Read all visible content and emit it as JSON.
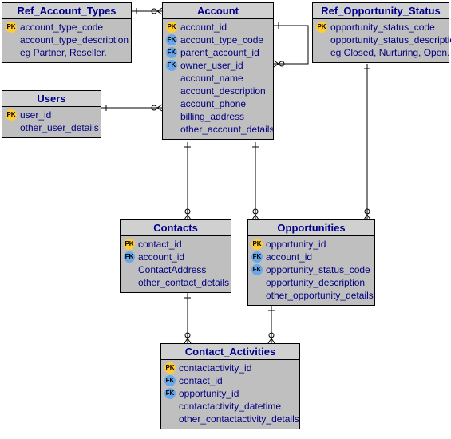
{
  "entities": {
    "ref_account_types": {
      "title": "Ref_Account_Types",
      "rows": [
        {
          "key": "pk",
          "name": "account_type_code"
        },
        {
          "key": "none",
          "name": "account_type_description"
        },
        {
          "key": "none",
          "name": "eg Partner, Reseller."
        }
      ]
    },
    "account": {
      "title": "Account",
      "rows": [
        {
          "key": "pk",
          "name": "account_id"
        },
        {
          "key": "fk",
          "name": "account_type_code"
        },
        {
          "key": "fk",
          "name": "parent_account_id"
        },
        {
          "key": "fk",
          "name": "owner_user_id"
        },
        {
          "key": "none",
          "name": "account_name"
        },
        {
          "key": "none",
          "name": "account_description"
        },
        {
          "key": "none",
          "name": "account_phone"
        },
        {
          "key": "none",
          "name": "billing_address"
        },
        {
          "key": "none",
          "name": "other_account_details"
        }
      ]
    },
    "ref_opportunity_status": {
      "title": "Ref_Opportunity_Status",
      "rows": [
        {
          "key": "pk",
          "name": "opportunity_status_code"
        },
        {
          "key": "none",
          "name": "opportunity_status_description"
        },
        {
          "key": "none",
          "name": "eg Closed, Nurturing, Open."
        }
      ]
    },
    "users": {
      "title": "Users",
      "rows": [
        {
          "key": "pk",
          "name": "user_id"
        },
        {
          "key": "none",
          "name": "other_user_details"
        }
      ]
    },
    "contacts": {
      "title": "Contacts",
      "rows": [
        {
          "key": "pk",
          "name": "contact_id"
        },
        {
          "key": "fk",
          "name": "account_id"
        },
        {
          "key": "none",
          "name": "ContactAddress"
        },
        {
          "key": "none",
          "name": "other_contact_details"
        }
      ]
    },
    "opportunities": {
      "title": "Opportunities",
      "rows": [
        {
          "key": "pk",
          "name": "opportunity_id"
        },
        {
          "key": "fk",
          "name": "account_id"
        },
        {
          "key": "fk",
          "name": "opportunity_status_code"
        },
        {
          "key": "none",
          "name": "opportunity_description"
        },
        {
          "key": "none",
          "name": "other_opportunity_details"
        }
      ]
    },
    "contact_activities": {
      "title": "Contact_Activities",
      "rows": [
        {
          "key": "pk",
          "name": "contactactivity_id"
        },
        {
          "key": "fk",
          "name": "contact_id"
        },
        {
          "key": "fk",
          "name": "opportunity_id"
        },
        {
          "key": "none",
          "name": "contactactivity_datetime"
        },
        {
          "key": "none",
          "name": "other_contactactivity_details"
        }
      ]
    }
  },
  "chart_data": {
    "type": "er-diagram",
    "relationships": [
      {
        "from": "Account.account_type_code",
        "to": "Ref_Account_Types.account_type_code",
        "cardinality": "many-to-one"
      },
      {
        "from": "Account.parent_account_id",
        "to": "Account.account_id",
        "cardinality": "many-to-one (self)"
      },
      {
        "from": "Account.owner_user_id",
        "to": "Users.user_id",
        "cardinality": "many-to-one"
      },
      {
        "from": "Contacts.account_id",
        "to": "Account.account_id",
        "cardinality": "many-to-one"
      },
      {
        "from": "Opportunities.account_id",
        "to": "Account.account_id",
        "cardinality": "many-to-one"
      },
      {
        "from": "Opportunities.opportunity_status_code",
        "to": "Ref_Opportunity_Status.opportunity_status_code",
        "cardinality": "many-to-one"
      },
      {
        "from": "Contact_Activities.contact_id",
        "to": "Contacts.contact_id",
        "cardinality": "many-to-one"
      },
      {
        "from": "Contact_Activities.opportunity_id",
        "to": "Opportunities.opportunity_id",
        "cardinality": "many-to-one"
      }
    ]
  }
}
